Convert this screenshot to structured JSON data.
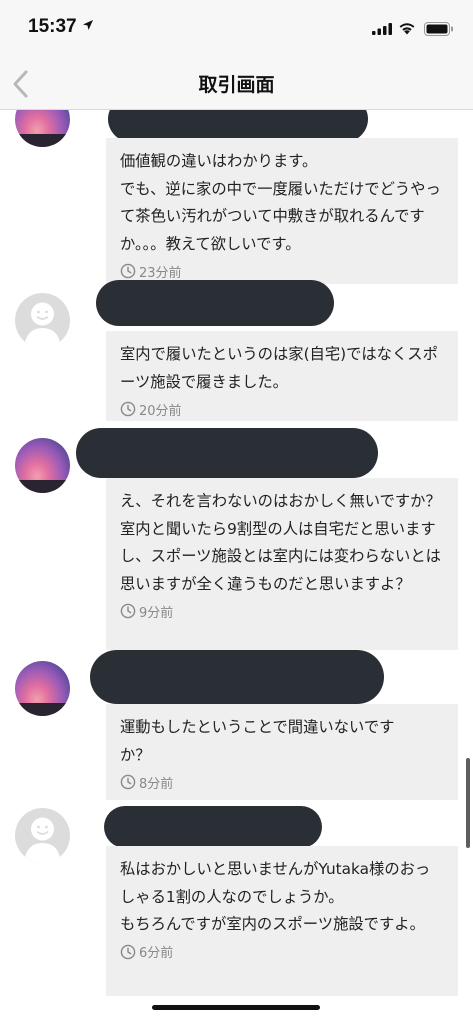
{
  "status_bar": {
    "time": "15:37"
  },
  "nav": {
    "title": "取引画面"
  },
  "messages": [
    {
      "avatar": "sunset-photo-avatar",
      "text": "価値観の違いはわかります。\nでも、逆に家の中で一度履いただけでどうやって茶色い汚れがついて中敷きが取れるんですか。。。教えて欲しいです。",
      "time": "23分前"
    },
    {
      "avatar": "default-user-avatar",
      "text": "室内で履いたというのは家(自宅)ではなくスポーツ施設で履きました。",
      "time": "20分前"
    },
    {
      "avatar": "sunset-photo-avatar",
      "text": "え、それを言わないのはおかしく無いですか？室内と聞いたら9割型の人は自宅だと思いますし、スポーツ施設とは室内には変わらないとは思いますが全く違うものだと思いますよ？",
      "time": "9分前"
    },
    {
      "avatar": "sunset-photo-avatar",
      "text": "運動もしたということで間違いないですか？",
      "time": "8分前"
    },
    {
      "avatar": "default-user-avatar",
      "text": "私はおかしいと思いませんがYutaka様のおっしゃる1割の人なのでしょうか。\nもちろんですが室内のスポーツ施設ですよ。",
      "time": "6分前"
    }
  ]
}
